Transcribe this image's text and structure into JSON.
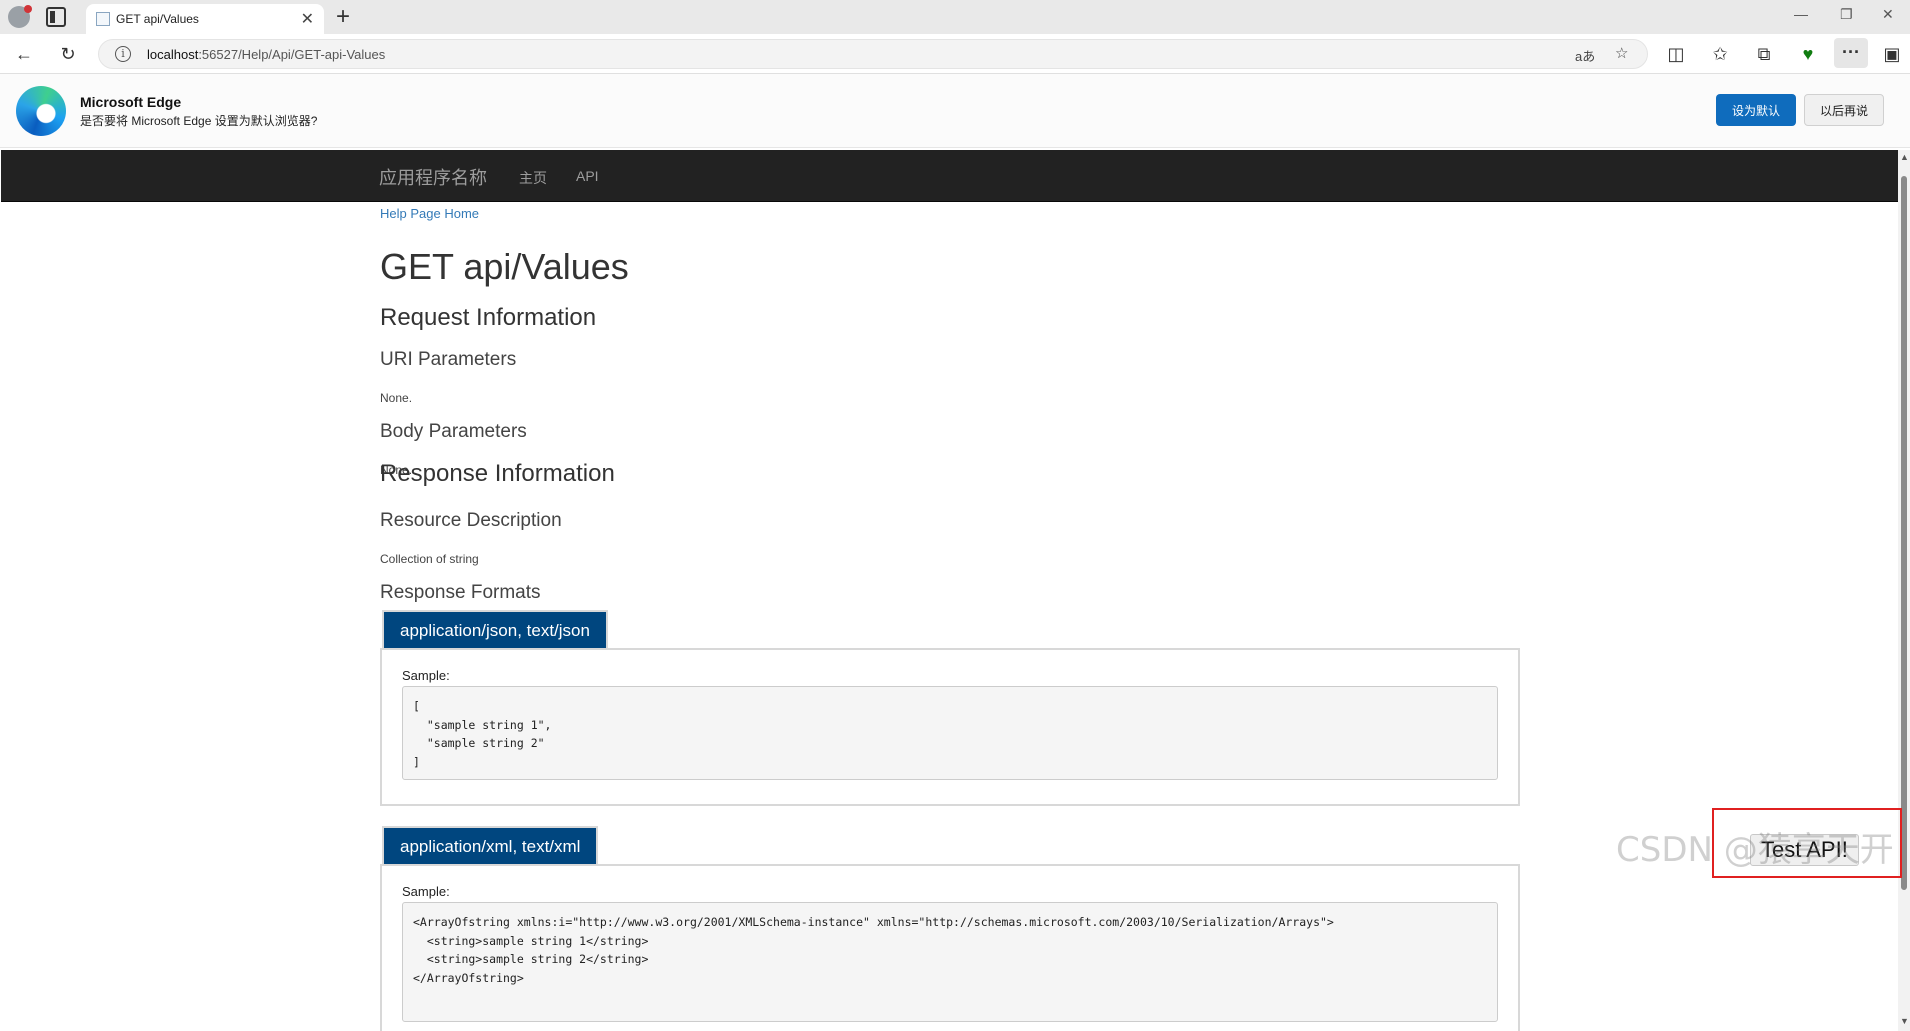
{
  "browser": {
    "tab_title": "GET api/Values",
    "tab_close": "✕",
    "new_tab": "+",
    "window_controls": {
      "minimize": "—",
      "restore": "❐",
      "close": "✕"
    },
    "url_host": "localhost",
    "url_rest": ":56527/Help/Api/GET-api-Values",
    "icons": [
      "back-icon",
      "refresh-icon",
      "info-icon",
      "read-aloud-icon",
      "favorite-icon",
      "split-screen-icon",
      "favorites-icon",
      "collections-icon",
      "browser-essentials-icon",
      "more-icon",
      "sidebar-icon"
    ]
  },
  "banner": {
    "title": "Microsoft Edge",
    "text": "是否要将 Microsoft Edge 设置为默认浏览器?",
    "primary": "设为默认",
    "secondary": "以后再说"
  },
  "navbar": {
    "brand": "应用程序名称",
    "links": [
      "主页",
      "API"
    ]
  },
  "page": {
    "help_link": "Help Page Home",
    "title": "GET api/Values",
    "request_info": "Request Information",
    "uri_params": "URI Parameters",
    "uri_params_value": "None.",
    "body_params": "Body Parameters",
    "body_params_value": "None.",
    "response_info": "Response Information",
    "resource_desc": "Resource Description",
    "resource_desc_value": "Collection of string",
    "response_formats": "Response Formats",
    "formats": [
      {
        "name": "application/json, text/json",
        "sample_label": "Sample:",
        "sample": "[\n  \"sample string 1\",\n  \"sample string 2\"\n]"
      },
      {
        "name": "application/xml, text/xml",
        "sample_label": "Sample:",
        "sample": "<ArrayOfstring xmlns:i=\"http://www.w3.org/2001/XMLSchema-instance\" xmlns=\"http://schemas.microsoft.com/2003/10/Serialization/Arrays\">\n  <string>sample string 1</string>\n  <string>sample string 2</string>\n</ArrayOfstring>"
      }
    ]
  },
  "test_api": {
    "label": "Test API!"
  },
  "watermark": "CSDN @猿享天开",
  "colors": {
    "navbar": "#222222",
    "format_tab": "#00467f",
    "link": "#337ab7",
    "edge_primary": "#0f6cbd",
    "highlight": "#e02020"
  }
}
